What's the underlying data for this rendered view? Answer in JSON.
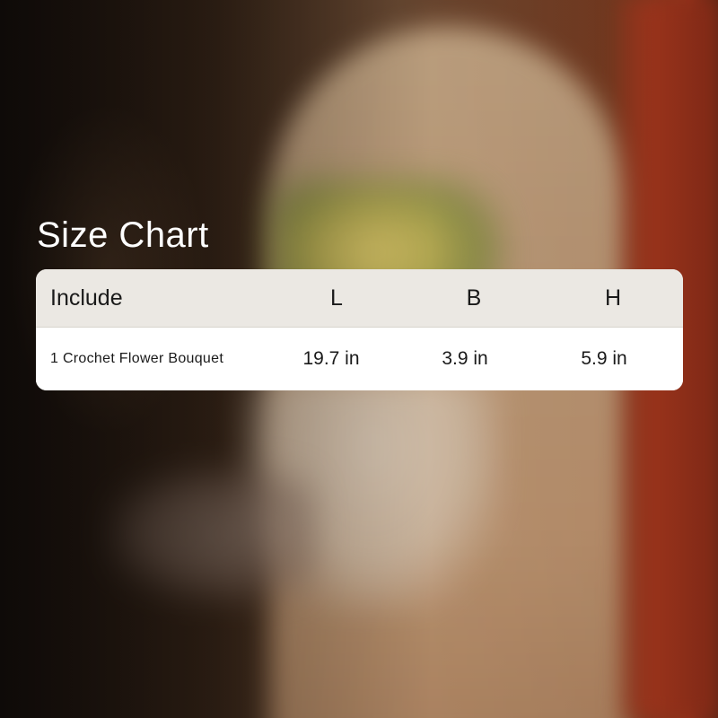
{
  "title": "Size Chart",
  "table": {
    "headers": {
      "include": "Include",
      "l": "L",
      "b": "B",
      "h": "H"
    },
    "rows": [
      {
        "include": "1 Crochet Flower Bouquet",
        "l": "19.7 in",
        "b": "3.9 in",
        "h": "5.9 in"
      }
    ]
  }
}
